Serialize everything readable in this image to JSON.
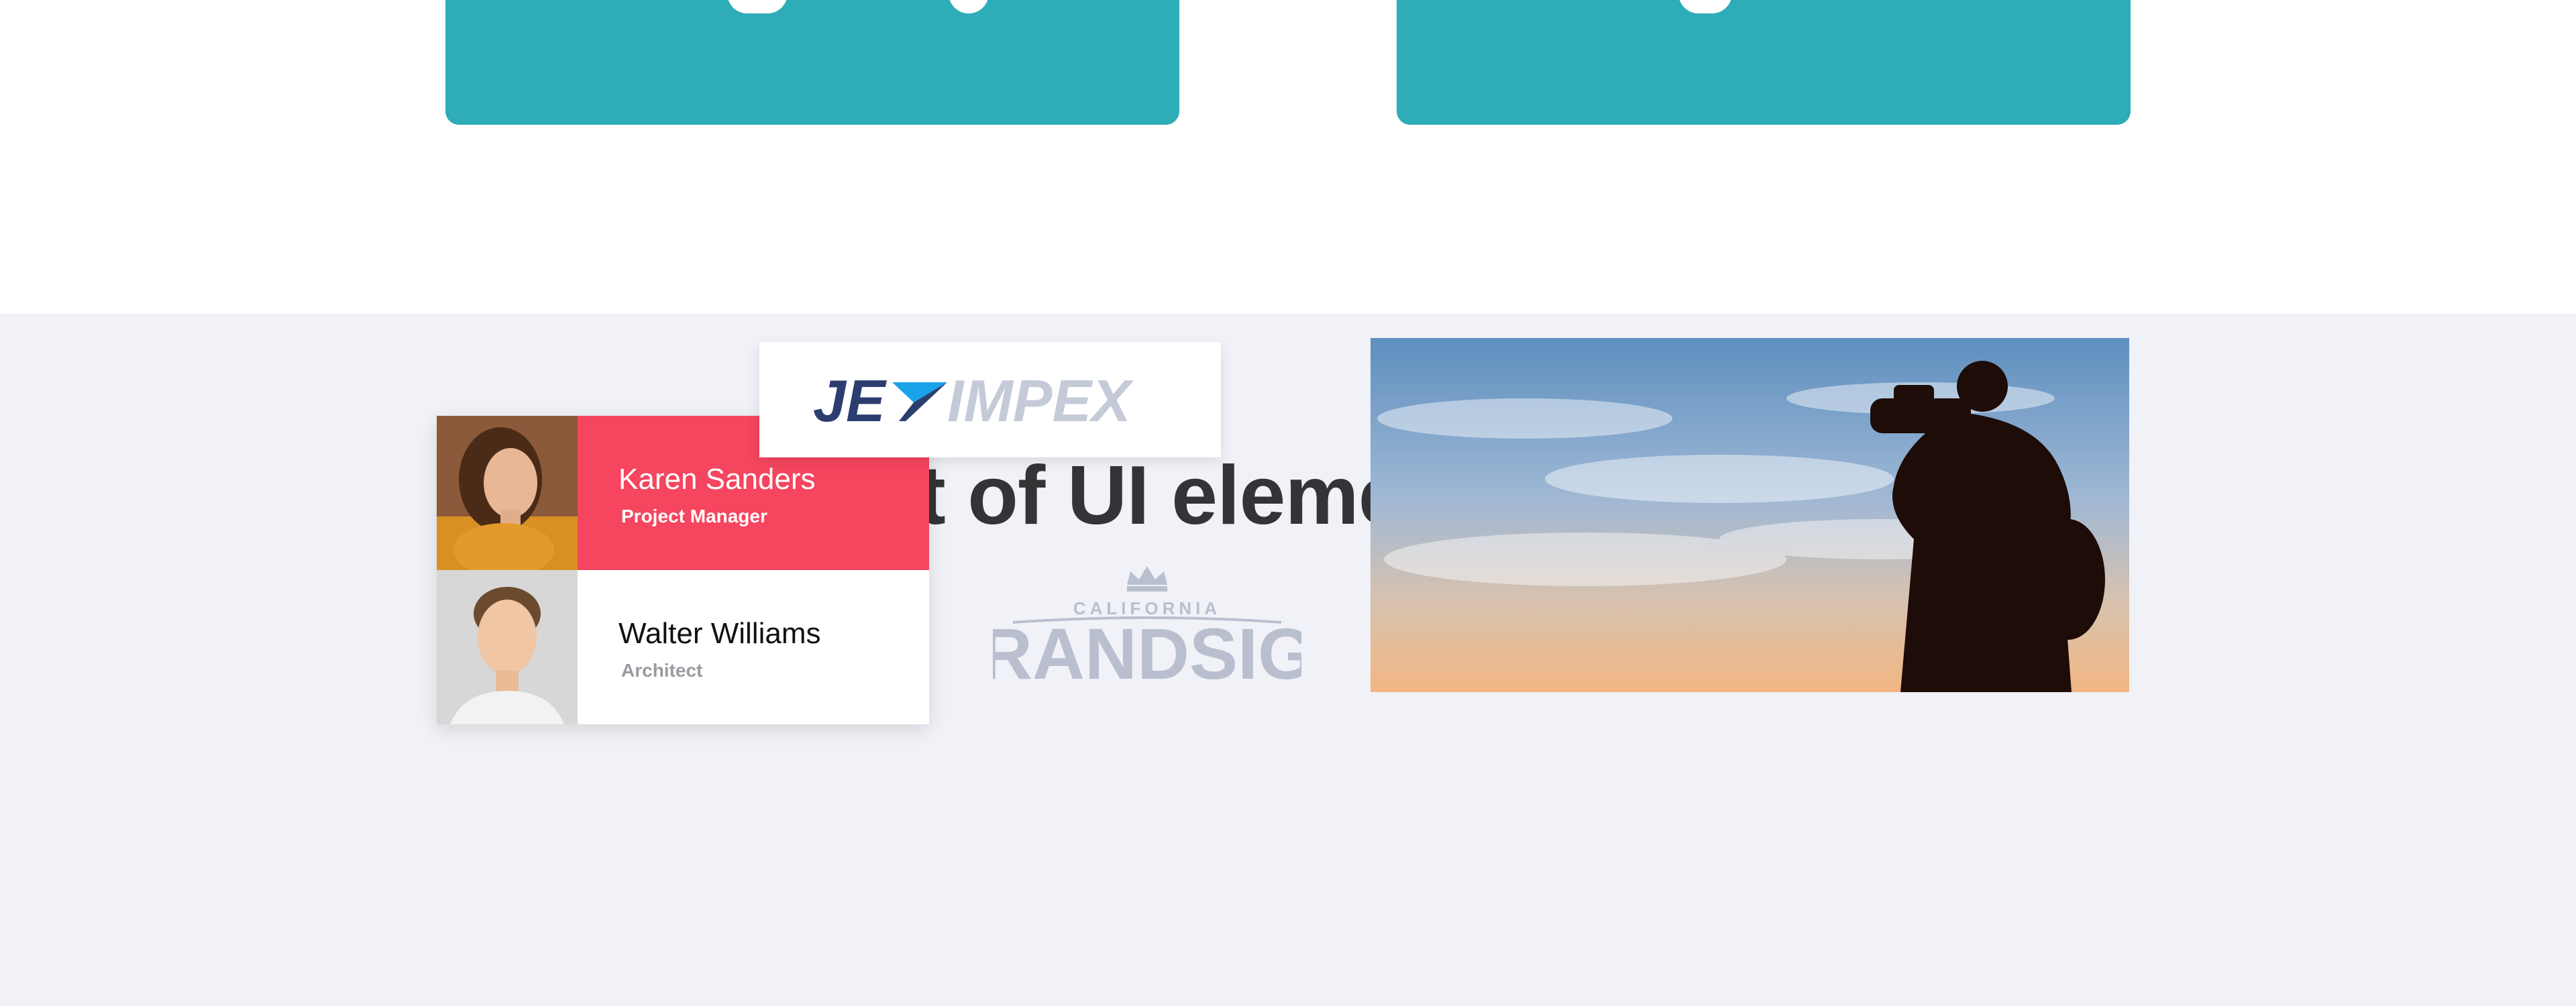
{
  "section": {
    "title": "Huge set of UI elements and blocks"
  },
  "team": [
    {
      "name": "Karen Sanders",
      "role": "Project Manager",
      "active": true
    },
    {
      "name": "Walter Williams",
      "role": "Architect",
      "active": false
    }
  ],
  "logos": {
    "jetimpex": {
      "part1": "JE",
      "part2": "IMPEX"
    },
    "brandsign": {
      "top": "CALIFORNIA",
      "main": "BRANDSIGN"
    }
  },
  "colors": {
    "teal": "#2eacb7",
    "accent_red": "#f5455f",
    "section_bg": "#f1f2f7",
    "heading": "#333436",
    "logo_navy": "#2c3e70",
    "logo_blue": "#1aa3e8",
    "logo_gray": "#c5cad8"
  },
  "icons": {
    "jet_mark": "plane-arrow-icon",
    "crown": "crown-icon"
  }
}
